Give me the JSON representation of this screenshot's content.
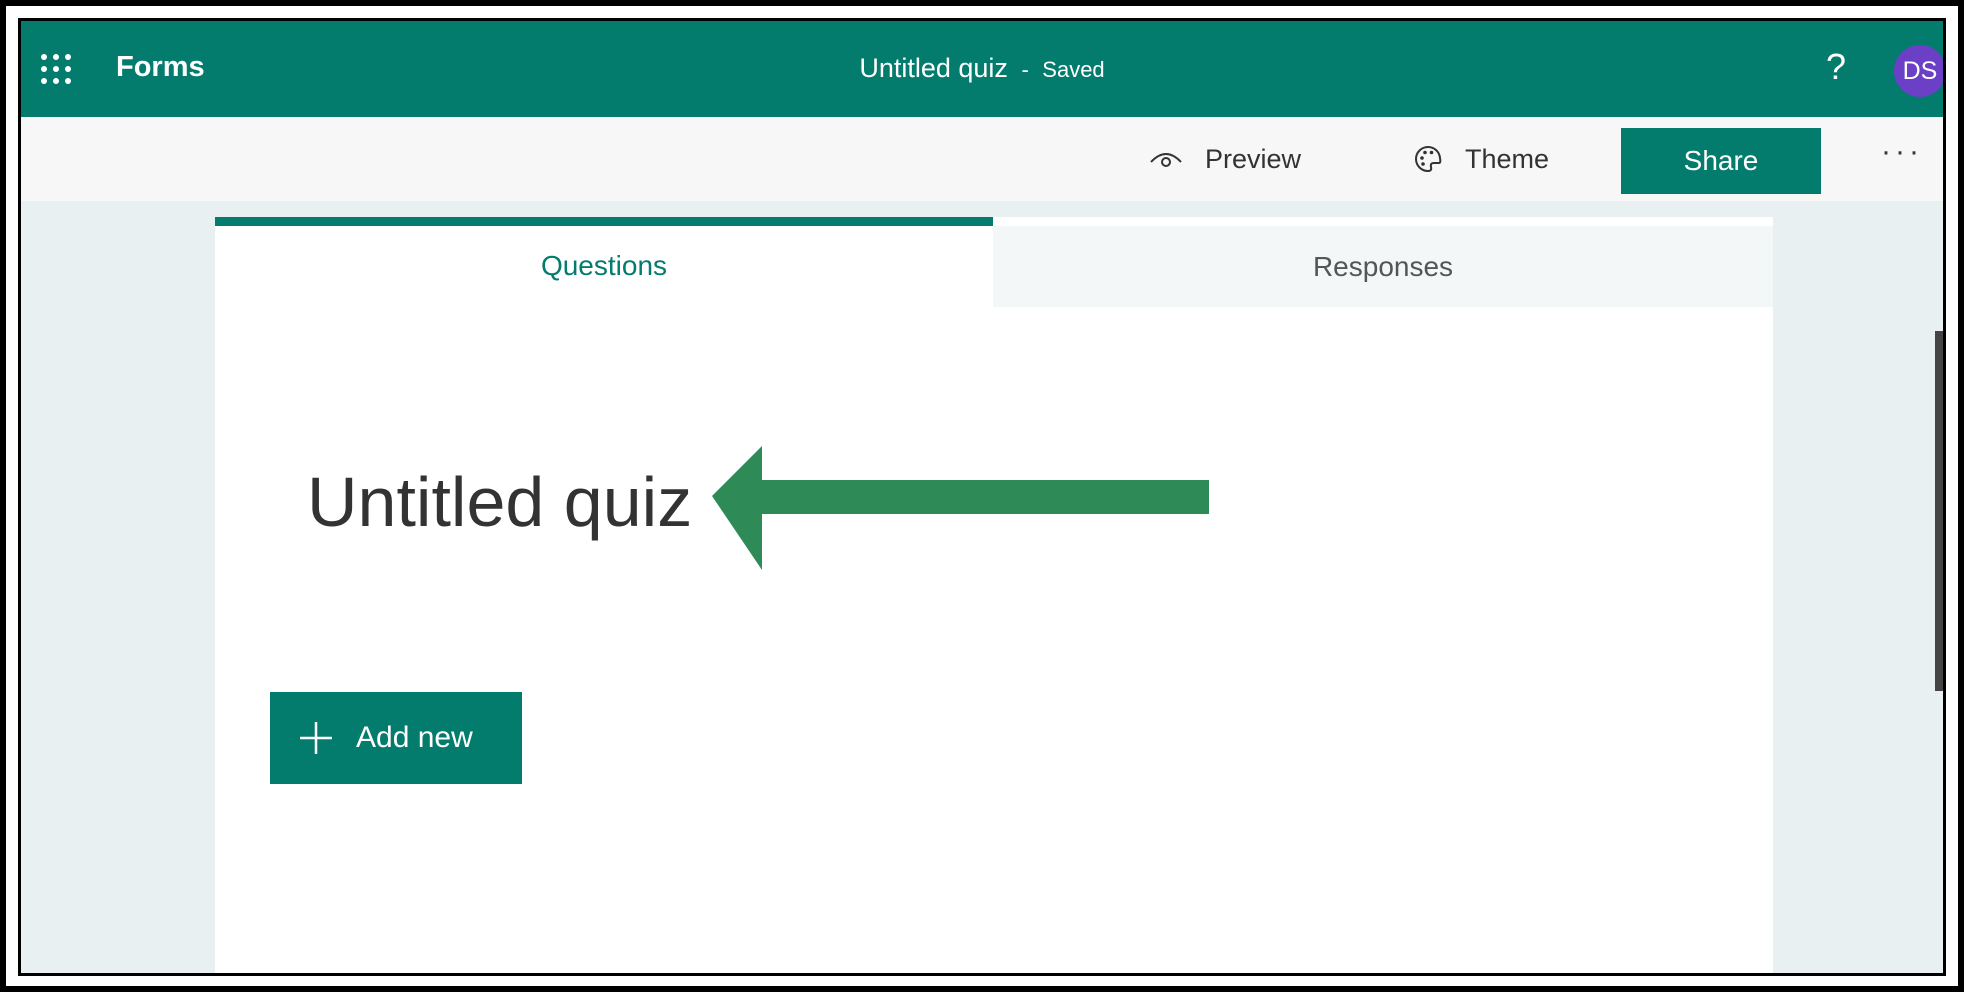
{
  "topbar": {
    "app_name": "Forms",
    "doc_title": "Untitled quiz",
    "separator": "-",
    "save_status": "Saved",
    "help_label": "?",
    "avatar_initials": "DS",
    "bg_color": "#037c6e",
    "avatar_color": "#6b3fc6"
  },
  "cmdbar": {
    "preview_label": "Preview",
    "theme_label": "Theme",
    "share_label": "Share",
    "more_label": "···"
  },
  "tabs": [
    {
      "label": "Questions",
      "active": true
    },
    {
      "label": "Responses",
      "active": false
    }
  ],
  "form": {
    "title": "Untitled quiz",
    "add_new_label": "Add new"
  },
  "annotation": {
    "arrow_color": "#2e8b57",
    "arrow_direction": "left"
  },
  "icons": [
    "waffle-icon",
    "help-icon",
    "eye-icon",
    "palette-icon",
    "more-icon",
    "plus-icon",
    "arrow-left-icon"
  ]
}
